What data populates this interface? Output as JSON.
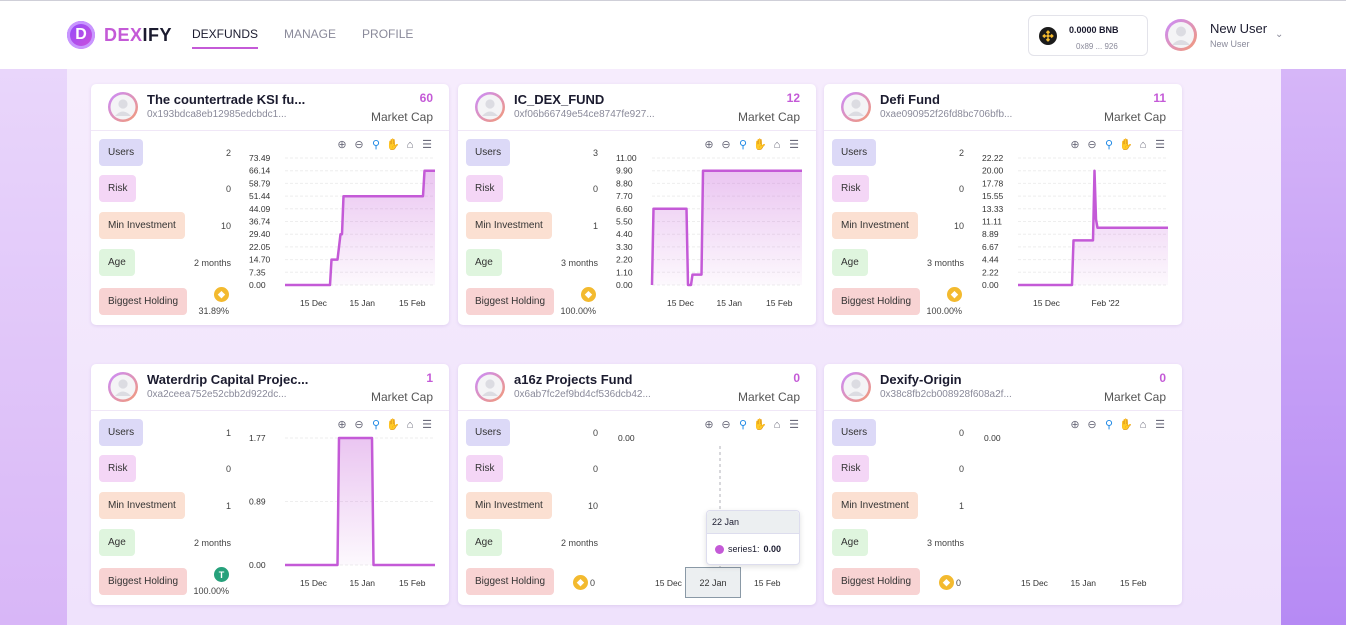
{
  "app": {
    "logo_letter": "D",
    "brand_part1": "DEX",
    "brand_part2": "IFY",
    "nav": [
      "DEXFUNDS",
      "MANAGE",
      "PROFILE"
    ]
  },
  "wallet": {
    "balance": "0.0000 BNB",
    "address": "0x89 ... 926"
  },
  "user": {
    "name": "New User",
    "subtitle": "New User"
  },
  "labels": {
    "market_cap": "Market Cap",
    "users": "Users",
    "risk": "Risk",
    "min_investment": "Min Investment",
    "age": "Age",
    "biggest_holding": "Biggest Holding"
  },
  "colors": {
    "accent": "#c45ad7",
    "series": "#c45ad7"
  },
  "funds": [
    {
      "name": "The countertrade KSI fu...",
      "address": "0x193bdca8eb12985edcbdc1...",
      "market_cap": "60",
      "users": "2",
      "risk": "0",
      "min_investment": "10",
      "age": "2 months",
      "holding_icon": "bnb-icon",
      "holding_pct": "31.89%"
    },
    {
      "name": "IC_DEX_FUND",
      "address": "0xf06b66749e54ce8747fe927...",
      "market_cap": "12",
      "users": "3",
      "risk": "0",
      "min_investment": "1",
      "age": "3 months",
      "holding_icon": "bnb-icon",
      "holding_pct": "100.00%"
    },
    {
      "name": "Defi Fund",
      "address": "0xae090952f26fd8bc706bfb...",
      "market_cap": "11",
      "users": "2",
      "risk": "0",
      "min_investment": "10",
      "age": "3 months",
      "holding_icon": "bnb-icon",
      "holding_pct": "100.00%"
    },
    {
      "name": "Waterdrip Capital Projec...",
      "address": "0xa2ceea752e52cbb2d922dc...",
      "market_cap": "1",
      "users": "1",
      "risk": "0",
      "min_investment": "1",
      "age": "2 months",
      "holding_icon": "usdt-icon",
      "holding_pct": "100.00%"
    },
    {
      "name": "a16z Projects Fund",
      "address": "0x6ab7fc2ef9bd4cf536dcb42...",
      "market_cap": "0",
      "users": "0",
      "risk": "0",
      "min_investment": "10",
      "age": "2 months",
      "holding_icon": "bnb-icon",
      "holding_pct": "0"
    },
    {
      "name": "Dexify-Origin",
      "address": "0x38c8fb2cb008928f608a2f...",
      "market_cap": "0",
      "users": "0",
      "risk": "0",
      "min_investment": "1",
      "age": "3 months",
      "holding_icon": "bnb-icon",
      "holding_pct": "0"
    }
  ],
  "chart_toolbar": [
    "zoom-in-icon",
    "zoom-out-icon",
    "zoom-select-icon",
    "pan-hand-icon",
    "home-reset-icon",
    "menu-icon"
  ],
  "tooltip": {
    "date": "22 Jan",
    "series": "series1:",
    "value": "0.00",
    "xlabel": "22 Jan"
  },
  "chart_data": [
    {
      "type": "area",
      "yticks": [
        "73.49",
        "66.14",
        "58.79",
        "51.44",
        "44.09",
        "36.74",
        "29.40",
        "22.05",
        "14.70",
        "7.35",
        "0.00"
      ],
      "xticks": [
        "15 Dec",
        "15 Jan",
        "15 Feb"
      ],
      "ylim": [
        0,
        73.49
      ],
      "series": [
        {
          "values": [
            [
              0,
              0
            ],
            [
              0.3,
              0
            ],
            [
              0.31,
              14.7
            ],
            [
              0.35,
              14.7
            ],
            [
              0.36,
              22
            ],
            [
              0.37,
              29.4
            ],
            [
              0.38,
              29.4
            ],
            [
              0.39,
              51.4
            ],
            [
              0.6,
              51.4
            ],
            [
              0.61,
              51.4
            ],
            [
              0.92,
              51.4
            ],
            [
              0.93,
              66.1
            ],
            [
              1.0,
              66.1
            ]
          ]
        }
      ]
    },
    {
      "type": "area",
      "yticks": [
        "11.00",
        "9.90",
        "8.80",
        "7.70",
        "6.60",
        "5.50",
        "4.40",
        "3.30",
        "2.20",
        "1.10",
        "0.00"
      ],
      "xticks": [
        "15 Dec",
        "15 Jan",
        "15 Feb"
      ],
      "ylim": [
        0,
        11
      ],
      "series": [
        {
          "values": [
            [
              0,
              0
            ],
            [
              0.01,
              6.6
            ],
            [
              0.23,
              6.6
            ],
            [
              0.24,
              0
            ],
            [
              0.26,
              0
            ],
            [
              0.27,
              0.9
            ],
            [
              0.33,
              0.9
            ],
            [
              0.34,
              9.9
            ],
            [
              1.0,
              9.9
            ]
          ]
        }
      ]
    },
    {
      "type": "area",
      "yticks": [
        "22.22",
        "20.00",
        "17.78",
        "15.55",
        "13.33",
        "11.11",
        "8.89",
        "6.67",
        "4.44",
        "2.22",
        "0.00"
      ],
      "xticks": [
        "15 Dec",
        "Feb '22"
      ],
      "ylim": [
        0,
        22.22
      ],
      "series": [
        {
          "values": [
            [
              0,
              0
            ],
            [
              0.36,
              0
            ],
            [
              0.37,
              7.8
            ],
            [
              0.5,
              7.8
            ],
            [
              0.51,
              20.0
            ],
            [
              0.52,
              11.5
            ],
            [
              0.53,
              10.0
            ],
            [
              1.0,
              10.0
            ]
          ]
        }
      ]
    },
    {
      "type": "area",
      "yticks": [
        "1.77",
        "0.89",
        "0.00"
      ],
      "xticks": [
        "15 Dec",
        "15 Jan",
        "15 Feb"
      ],
      "ylim": [
        0,
        1.77
      ],
      "series": [
        {
          "values": [
            [
              0,
              0
            ],
            [
              0.35,
              0
            ],
            [
              0.36,
              1.77
            ],
            [
              0.58,
              1.77
            ],
            [
              0.59,
              0
            ],
            [
              1.0,
              0
            ]
          ]
        }
      ]
    },
    {
      "type": "area",
      "yticks": [
        "0.00"
      ],
      "xticks": [
        "15 Dec",
        "22 Jan",
        "15 Feb"
      ],
      "ylim": [
        0,
        1
      ],
      "series": []
    },
    {
      "type": "area",
      "yticks": [
        "0.00"
      ],
      "xticks": [
        "15 Dec",
        "15 Jan",
        "15 Feb"
      ],
      "ylim": [
        0,
        1
      ],
      "series": []
    }
  ]
}
